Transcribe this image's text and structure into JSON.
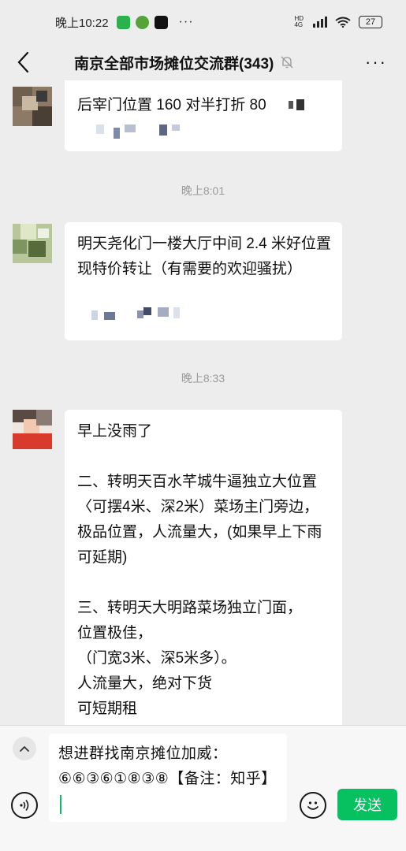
{
  "status_bar": {
    "time": "晚上10:22",
    "more": "···",
    "hd_label": "HD",
    "network_label": "4G",
    "battery": "27"
  },
  "header": {
    "title": "南京全部市场摊位交流群(343)",
    "more": "···"
  },
  "messages": [
    {
      "lines": [
        "后宰门位置 160 对半打折 80"
      ]
    },
    {
      "timestamp": "晚上8:01",
      "lines": [
        "明天尧化门一楼大厅中间 2.4 米好位置现特价转让（有需要的欢迎骚扰）"
      ]
    },
    {
      "timestamp": "晚上8:33",
      "paragraphs": [
        "早上没雨了",
        "二、转明天百水芊城牛逼独立大位置〈可摆4米、深2米）菜场主门旁边，极品位置，人流量大，(如果早上下雨可延期)",
        "三、转明天大明路菜场独立门面，\n位置极佳，\n（门宽3米、深5米多）。\n人流量大，绝对下货\n可短期租"
      ]
    }
  ],
  "input": {
    "value": "想进群找南京摊位加威：⑥⑥③⑥①⑧③⑧【备注：知乎】",
    "send_label": "发送"
  },
  "colors": {
    "accent": "#07c160",
    "background": "#ededed",
    "bubble": "#ffffff"
  }
}
